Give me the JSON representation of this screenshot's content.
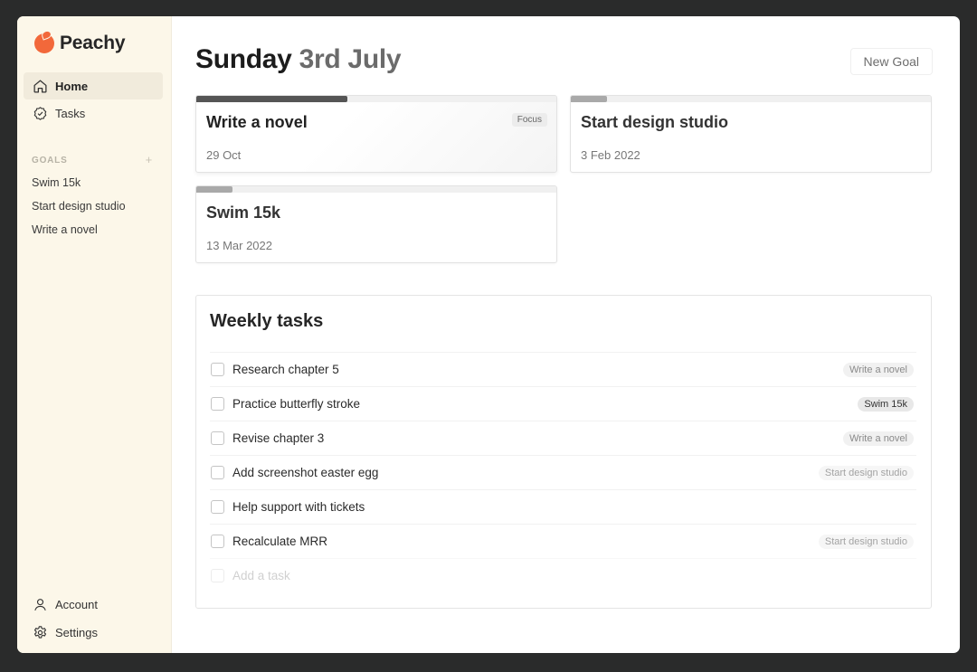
{
  "app": {
    "name": "Peachy",
    "brand_color": "#f2683a"
  },
  "sidebar": {
    "nav": [
      {
        "label": "Home",
        "icon": "home-icon",
        "active": true
      },
      {
        "label": "Tasks",
        "icon": "check-badge-icon",
        "active": false
      }
    ],
    "goals_heading": "GOALS",
    "goals_add": "+",
    "goals": [
      "Swim 15k",
      "Start design studio",
      "Write a novel"
    ],
    "bottom": [
      {
        "label": "Account",
        "icon": "user-icon"
      },
      {
        "label": "Settings",
        "icon": "gear-icon"
      }
    ]
  },
  "header": {
    "day": "Sunday",
    "date": "3rd July",
    "new_goal_label": "New Goal"
  },
  "goal_cards": [
    {
      "title": "Write a novel",
      "date": "29 Oct",
      "badge": "Focus",
      "progress": 0.42
    },
    {
      "title": "Start design studio",
      "date": "3 Feb 2022",
      "progress": 0.1
    },
    {
      "title": "Swim 15k",
      "date": "13 Mar 2022",
      "progress": 0.1
    }
  ],
  "weekly": {
    "title": "Weekly tasks",
    "tasks": [
      {
        "label": "Research chapter 5",
        "tag": "Write a novel"
      },
      {
        "label": "Practice butterfly stroke",
        "tag": "Swim 15k"
      },
      {
        "label": "Revise chapter 3",
        "tag": "Write a novel"
      },
      {
        "label": "Add screenshot easter egg",
        "tag": "Start design studio"
      },
      {
        "label": "Help support with tickets",
        "tag": ""
      },
      {
        "label": "Recalculate MRR",
        "tag": "Start design studio"
      }
    ],
    "add_placeholder": "Add a task"
  }
}
